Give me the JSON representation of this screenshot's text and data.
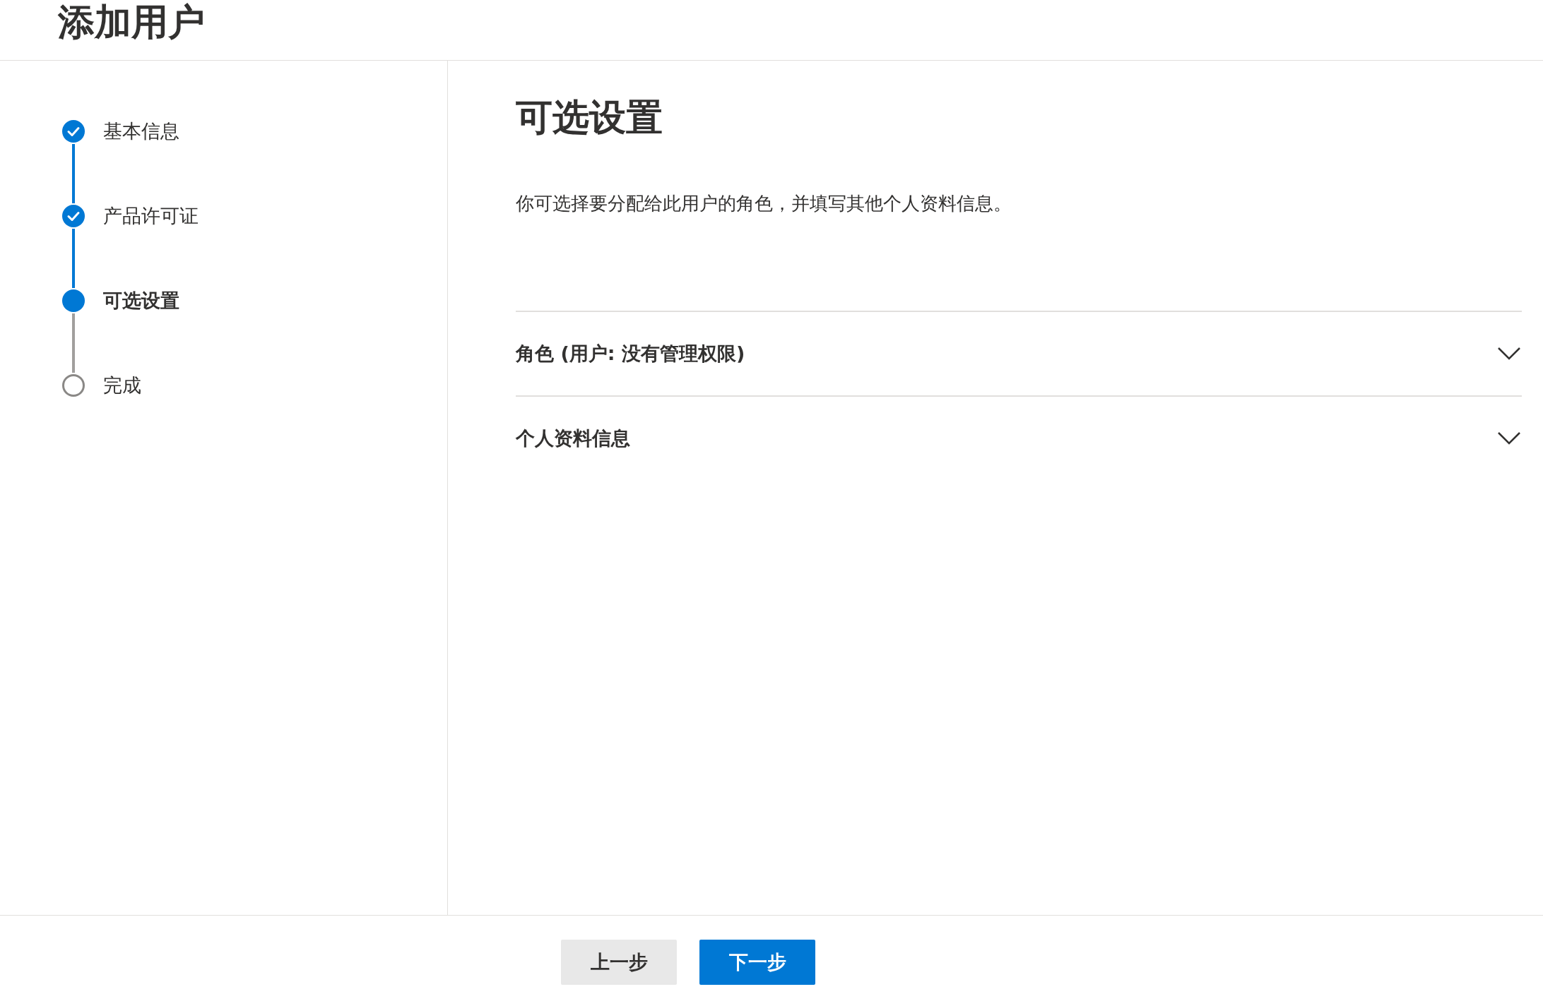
{
  "header": {
    "title": "添加用户"
  },
  "steps": [
    {
      "label": "基本信息",
      "kind": "completed"
    },
    {
      "label": "产品许可证",
      "kind": "completed"
    },
    {
      "label": "可选设置",
      "kind": "current"
    },
    {
      "label": "完成",
      "kind": "pending"
    }
  ],
  "content": {
    "heading": "可选设置",
    "description": "你可选择要分配给此用户的角色，并填写其他个人资料信息。",
    "sections": [
      {
        "label": "角色 (用户: 没有管理权限)",
        "expanded": false
      },
      {
        "label": "个人资料信息",
        "expanded": false
      }
    ]
  },
  "footer": {
    "buttons": [
      {
        "label": "上一步",
        "kind": "secondary"
      },
      {
        "label": "下一步",
        "kind": "primary"
      }
    ]
  }
}
